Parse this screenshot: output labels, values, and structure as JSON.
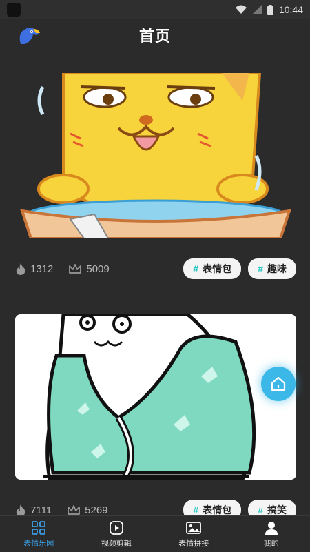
{
  "status_bar": {
    "time": "10:44"
  },
  "header": {
    "title": "首页"
  },
  "posts": [
    {
      "fire_count": "1312",
      "crown_count": "5009",
      "tags": [
        "表情包",
        "趣味"
      ],
      "tag_hash": "#"
    },
    {
      "fire_count": "7111",
      "crown_count": "5269",
      "tags": [
        "表情包",
        "搞笑"
      ],
      "tag_hash": "#"
    }
  ],
  "tabs": [
    {
      "label": "表情乐园",
      "icon": "grid-icon",
      "active": true
    },
    {
      "label": "视频剪辑",
      "icon": "play-icon",
      "active": false
    },
    {
      "label": "表情拼接",
      "icon": "image-icon",
      "active": false
    },
    {
      "label": "我的",
      "icon": "user-icon",
      "active": false
    }
  ],
  "colors": {
    "accent": "#3b9be0",
    "tag_hash": "#27c8c2",
    "background": "#2b2b2b",
    "float_button": "#3cb8e8"
  }
}
